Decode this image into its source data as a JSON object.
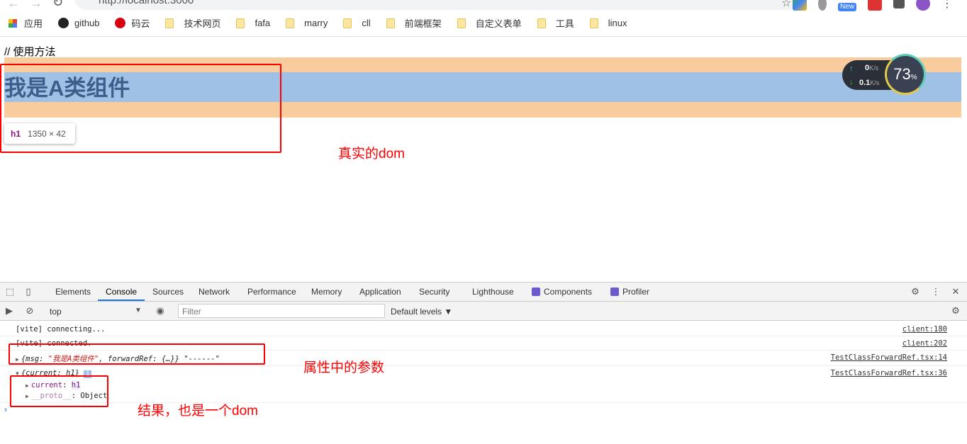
{
  "browser": {
    "url": "http://localhost:3000",
    "badge": "New"
  },
  "bookmarks": [
    {
      "label": "应用",
      "icon": "apps-grid-icon"
    },
    {
      "label": "github",
      "icon": "github-icon"
    },
    {
      "label": "码云",
      "icon": "gitee-icon"
    },
    {
      "label": "技术网页",
      "icon": "folder-icon"
    },
    {
      "label": "fafa",
      "icon": "folder-icon"
    },
    {
      "label": "marry",
      "icon": "folder-icon"
    },
    {
      "label": "cll",
      "icon": "folder-icon"
    },
    {
      "label": "前端框架",
      "icon": "folder-icon"
    },
    {
      "label": "自定义表单",
      "icon": "folder-icon"
    },
    {
      "label": "工具",
      "icon": "folder-icon"
    },
    {
      "label": "linux",
      "icon": "folder-icon"
    }
  ],
  "page": {
    "usage": "// 使用方法",
    "heading": "我是A类组件",
    "tooltip_tag": "h1",
    "tooltip_size": "1350 × 42"
  },
  "annotations": {
    "real_dom": "真实的dom",
    "props_param": "属性中的参数",
    "result": "结果，也是一个dom"
  },
  "speed_widget": {
    "up": "0",
    "up_unit": "K/s",
    "down": "0.1",
    "down_unit": "K/s",
    "percent": "73",
    "percent_sign": "%"
  },
  "devtools": {
    "tabs": [
      "Elements",
      "Console",
      "Sources",
      "Network",
      "Performance",
      "Memory",
      "Application",
      "Security",
      "Lighthouse",
      "Components",
      "Profiler"
    ],
    "active_tab": "Console",
    "context": "top",
    "filter_placeholder": "Filter",
    "levels": "Default levels ▼",
    "logs": [
      {
        "text": "[vite] connecting...",
        "source": "client:180"
      },
      {
        "text": "[vite] connected.",
        "source": "client:202"
      },
      {
        "pre": "{msg: ",
        "str": "\"我是A类组件\"",
        "post": ", forwardRef: {…}} \"------\"",
        "source": "TestClassForwardRef.tsx:14"
      },
      {
        "text": "{current: h1}",
        "source": "TestClassForwardRef.tsx:36"
      }
    ],
    "tree": [
      {
        "key": "current",
        "val": "h1"
      },
      {
        "key": "__proto__",
        "val": "Object"
      }
    ]
  }
}
